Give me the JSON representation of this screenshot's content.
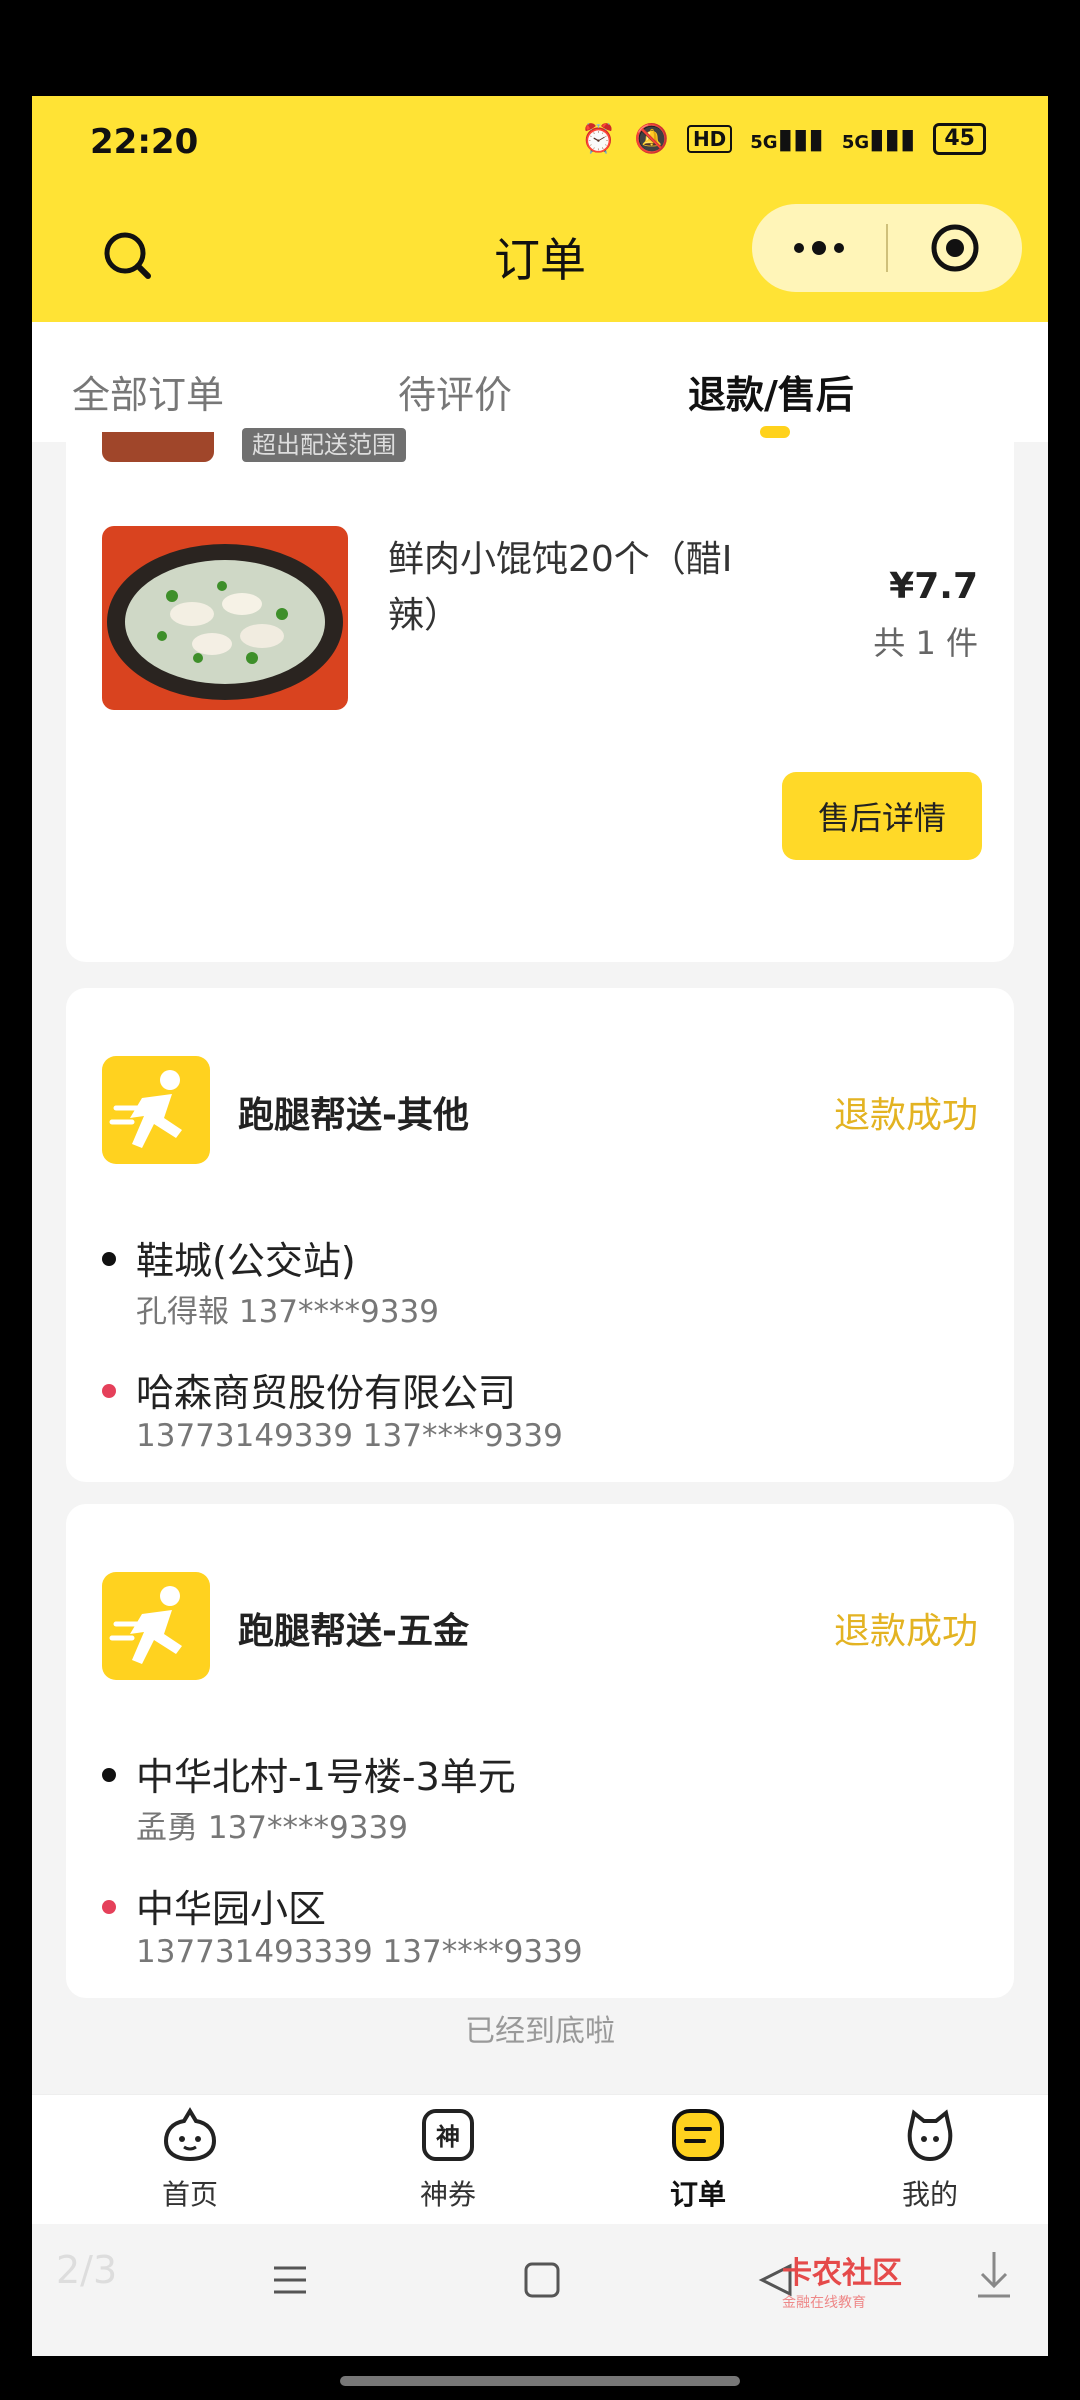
{
  "status_bar": {
    "time": "22:20",
    "hd_label": "HD",
    "network1": "5G",
    "network2": "5G",
    "battery": "45"
  },
  "header": {
    "title": "订单"
  },
  "tabs": [
    {
      "label": "全部订单",
      "active": false
    },
    {
      "label": "待评价",
      "active": false
    },
    {
      "label": "退款/售后",
      "active": true
    }
  ],
  "order1": {
    "partial_tag": "超出配送范围",
    "item_name": "鲜肉小馄饨20个（醋I辣）",
    "price": "¥7.7",
    "quantity": "共 1 件",
    "button": "售后详情"
  },
  "order2": {
    "service_title": "跑腿帮送-其他",
    "status": "退款成功",
    "from_address": "鞋城(公交站)",
    "from_contact": "孔得報 137****9339",
    "to_address": "哈森商贸股份有限公司",
    "to_contact": "13773149339 137****9339"
  },
  "order3": {
    "service_title": "跑腿帮送-五金",
    "status": "退款成功",
    "from_address": "中华北村-1号楼-3单元",
    "from_contact": "孟勇 137****9339",
    "to_address": "中华园小区",
    "to_contact": "137731493339 137****9339"
  },
  "end_text": "已经到底啦",
  "bottom_nav": [
    {
      "label": "首页",
      "icon": "home-face-icon"
    },
    {
      "label": "神券",
      "icon": "coupon-icon"
    },
    {
      "label": "订单",
      "icon": "order-icon",
      "active": true
    },
    {
      "label": "我的",
      "icon": "profile-icon"
    }
  ],
  "system_nav": {
    "page_indicator": "2/3"
  },
  "watermark": {
    "title": "卡农社区",
    "subtitle": "金融在线教育"
  },
  "colors": {
    "brand_yellow": "#ffe335",
    "status_gold": "#e3b322",
    "from_dot": "#111111",
    "to_dot": "#e5405a"
  }
}
